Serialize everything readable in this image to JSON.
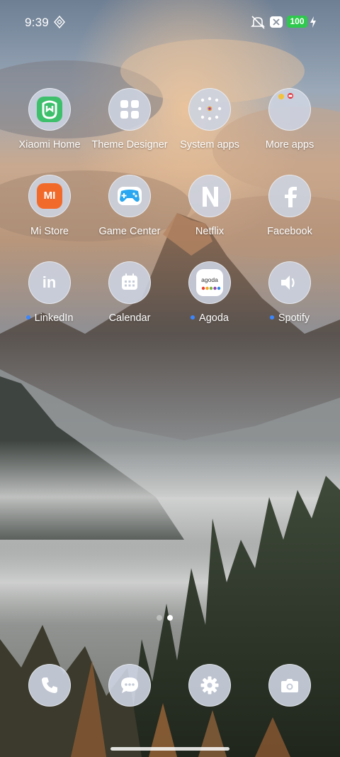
{
  "status_bar": {
    "time": "9:39",
    "battery": "100",
    "icons": [
      "sync-icon",
      "mute-icon",
      "notification-icon",
      "charging-icon"
    ]
  },
  "apps": [
    {
      "label": "Xiaomi Home",
      "icon": "xiaomi-home-icon",
      "new_dot": false
    },
    {
      "label": "Theme Designer",
      "icon": "theme-designer-icon",
      "new_dot": false
    },
    {
      "label": "System apps",
      "icon": "folder-icon",
      "new_dot": false
    },
    {
      "label": "More apps",
      "icon": "folder-icon",
      "new_dot": false
    },
    {
      "label": "Mi Store",
      "icon": "mi-store-icon",
      "new_dot": false
    },
    {
      "label": "Game Center",
      "icon": "game-controller-icon",
      "new_dot": false
    },
    {
      "label": "Netflix",
      "icon": "netflix-icon",
      "new_dot": false
    },
    {
      "label": "Facebook",
      "icon": "facebook-icon",
      "new_dot": false
    },
    {
      "label": "LinkedIn",
      "icon": "linkedin-icon",
      "new_dot": true
    },
    {
      "label": "Calendar",
      "icon": "calendar-icon",
      "new_dot": false
    },
    {
      "label": "Agoda",
      "icon": "agoda-icon",
      "new_dot": true
    },
    {
      "label": "Spotify",
      "icon": "spotify-icon",
      "new_dot": true
    }
  ],
  "agoda_logo_text": "agoda",
  "mi_store_logo_text": "MI",
  "dock": [
    "phone-icon",
    "messages-icon",
    "settings-icon",
    "camera-icon"
  ],
  "page_indicator": {
    "pages": 2,
    "current": 2
  },
  "colors": {
    "icon_background": "#cdd4e2",
    "new_dot": "#3a86ff",
    "battery": "#2ec94d",
    "mi_store": "#f26a2a",
    "xiaomi_home": "#3dbf6b"
  }
}
